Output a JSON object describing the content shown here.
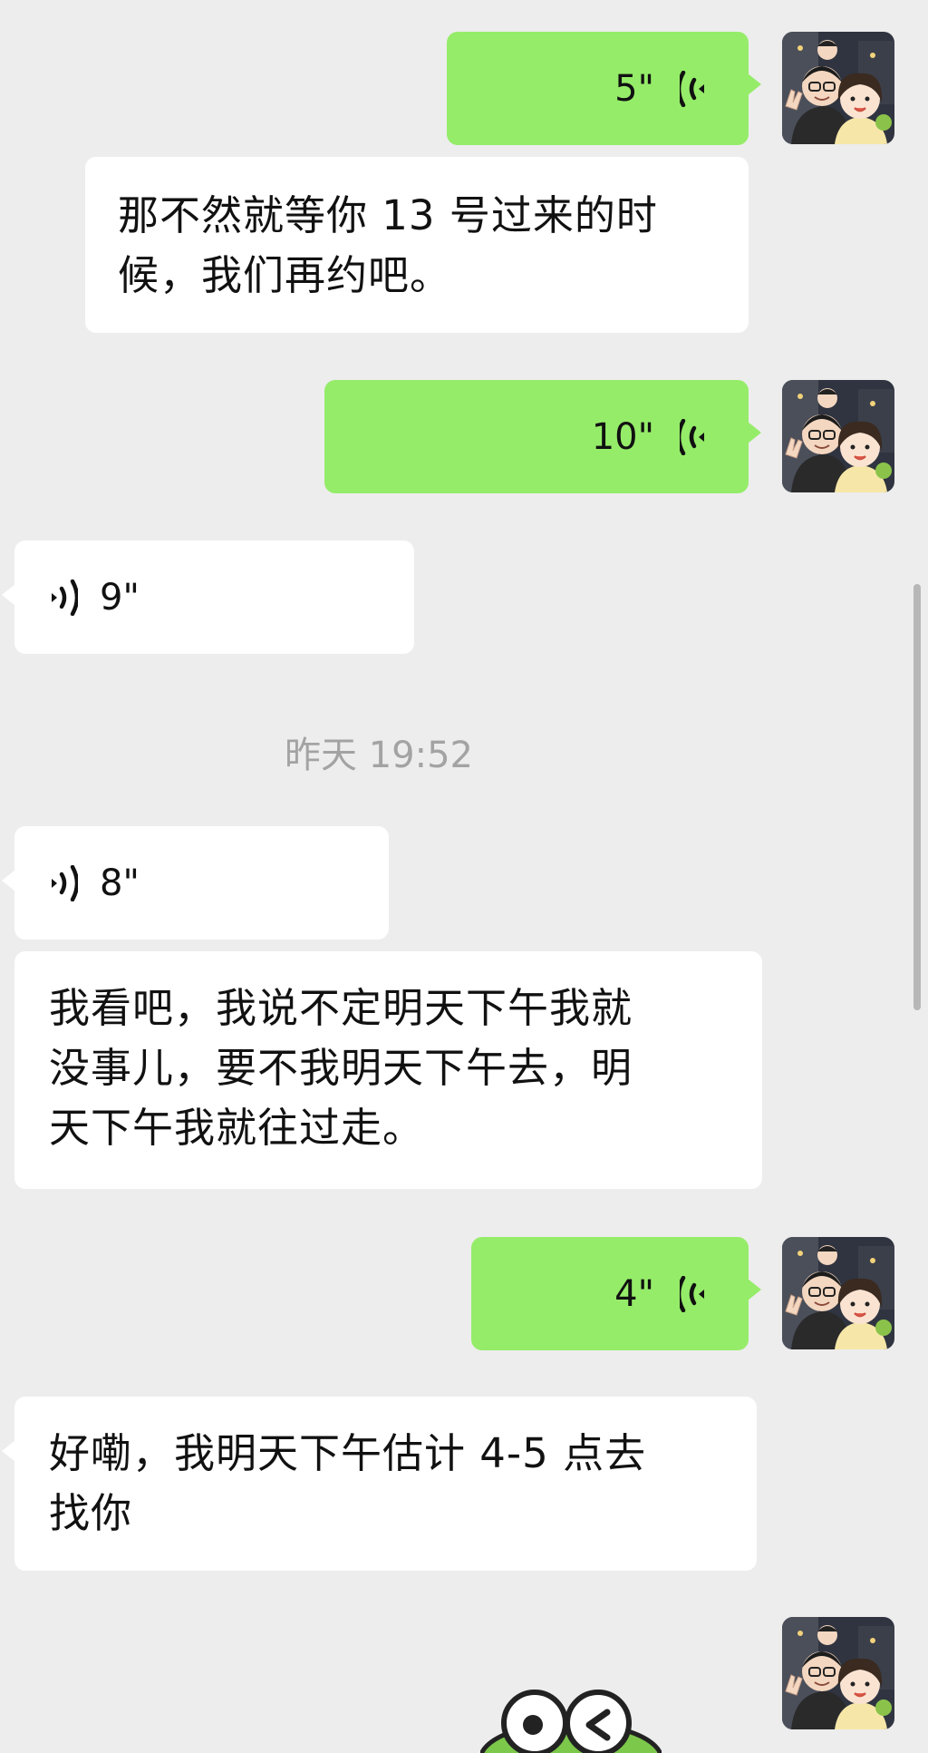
{
  "messages": [
    {
      "voice_duration": "5\""
    },
    {
      "text": "那不然就等你 13 号过来的时\n候，我们再约吧。"
    },
    {
      "voice_duration": "10\""
    },
    {
      "voice_duration": "9\""
    },
    {
      "timestamp": "昨天 19:52"
    },
    {
      "voice_duration": "8\""
    },
    {
      "text": "我看吧，我说不定明天下午我就\n没事儿，要不我明天下午去，明\n天下午我就往过走。"
    },
    {
      "voice_duration": "4\""
    },
    {
      "text": "好嘞，我明天下午估计 4-5 点去\n找你"
    }
  ],
  "colors": {
    "outgoing_bubble": "#95ec69",
    "incoming_bubble": "#ffffff",
    "background": "#ededed",
    "timestamp": "#a3a3a3"
  },
  "icons": {
    "outgoing_voice": "voice-wave-icon",
    "incoming_voice": "voice-wave-icon",
    "avatar": "cartoon-couple-avatar",
    "sticker": "frog-sticker"
  }
}
